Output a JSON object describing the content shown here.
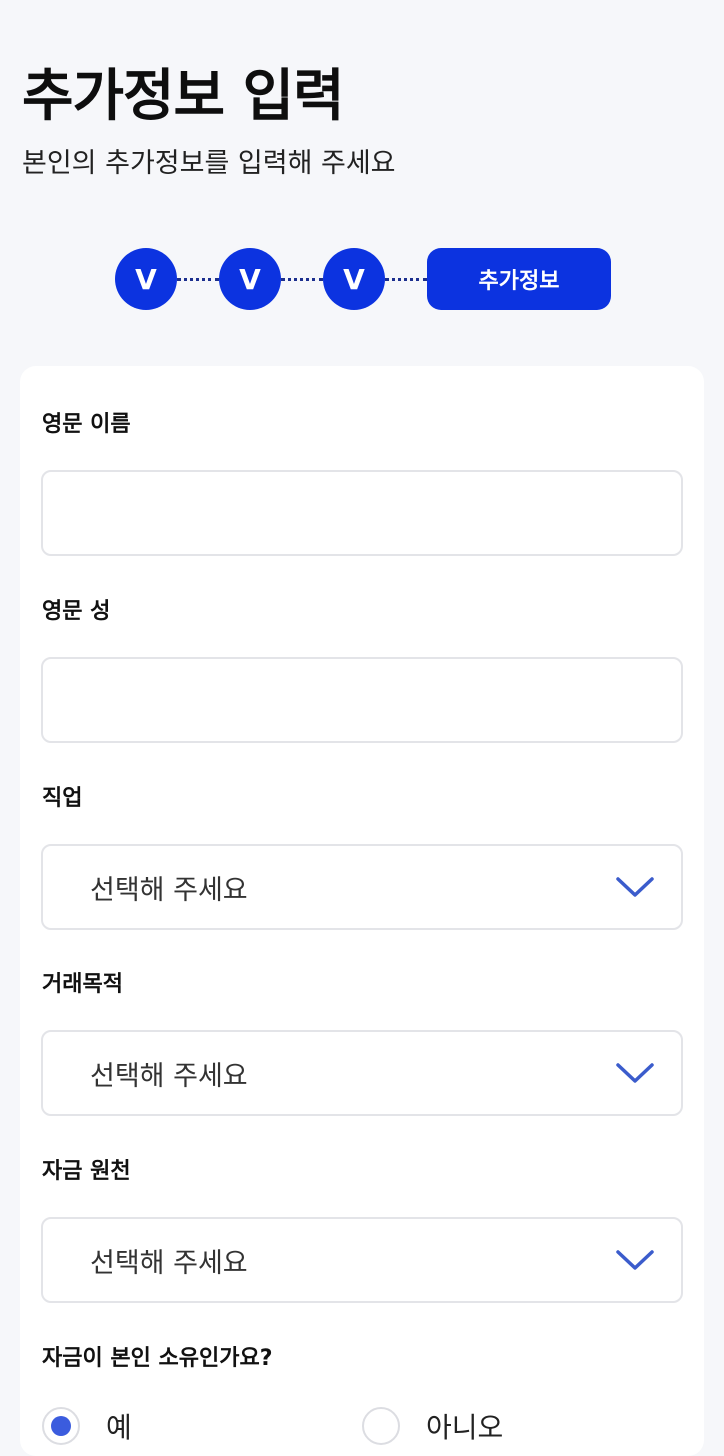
{
  "header": {
    "title": "추가정보 입력",
    "subtitle": "본인의 추가정보를 입력해 주세요"
  },
  "stepper": {
    "done_mark": "V",
    "current_label": "추가정보",
    "accent_color": "#0c33e0"
  },
  "form": {
    "english_first_name": {
      "label": "영문 이름",
      "value": ""
    },
    "english_last_name": {
      "label": "영문 성",
      "value": ""
    },
    "occupation": {
      "label": "직업",
      "value": "선택해 주세요"
    },
    "transaction_purpose": {
      "label": "거래목적",
      "value": "선택해 주세요"
    },
    "fund_source": {
      "label": "자금 원천",
      "value": "선택해 주세요"
    },
    "fund_ownership": {
      "label": "자금이 본인 소유인가요?",
      "options": [
        "예",
        "아니오"
      ],
      "selected": "예"
    }
  },
  "icons": {
    "dropdown": "chevron-down-icon"
  }
}
